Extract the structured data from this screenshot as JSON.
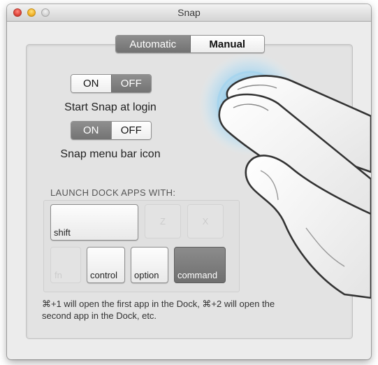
{
  "window": {
    "title": "Snap"
  },
  "tabs": [
    {
      "label": "Automatic",
      "selected": true
    },
    {
      "label": "Manual",
      "selected": false
    }
  ],
  "login_toggle": {
    "on_label": "ON",
    "off_label": "OFF",
    "value": "OFF",
    "caption": "Start Snap at login"
  },
  "menubar_toggle": {
    "on_label": "ON",
    "off_label": "OFF",
    "value": "ON",
    "caption": "Snap menu bar icon"
  },
  "launch": {
    "title": "LAUNCH DOCK APPS WITH:",
    "keys": {
      "shift": "shift",
      "z": "Z",
      "x": "X",
      "fn": "fn",
      "control": "control",
      "option": "option",
      "command": "command"
    }
  },
  "hint": {
    "line1": "⌘+1 will open the first app in the Dock, ⌘+2 will open the",
    "line2": "second app in the Dock, etc."
  },
  "colors": {
    "selected_segment": "#7f7f7f",
    "panel_bg": "#e3e3e3",
    "glow": "#7cc6ee"
  },
  "icons": {
    "illustration": "hand-two-finger-tap-icon"
  }
}
